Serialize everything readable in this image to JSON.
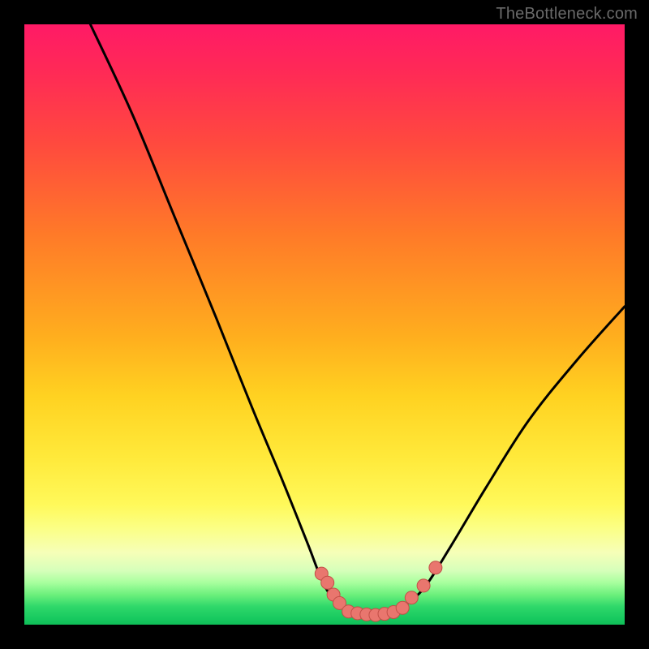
{
  "watermark": "TheBottleneck.com",
  "chart_data": {
    "type": "line",
    "title": "",
    "xlabel": "",
    "ylabel": "",
    "xlim": [
      0,
      100
    ],
    "ylim": [
      0,
      100
    ],
    "grid": false,
    "legend": false,
    "series": [
      {
        "name": "left_curve",
        "x": [
          11,
          18,
          25,
          32,
          38,
          43,
          47,
          50,
          52.5,
          55
        ],
        "y": [
          100,
          85,
          68,
          51,
          36,
          24,
          14,
          6.5,
          3.5,
          2.3
        ]
      },
      {
        "name": "right_curve",
        "x": [
          63,
          66.5,
          71,
          77,
          84,
          92,
          100
        ],
        "y": [
          3,
          6,
          13,
          23,
          34,
          44,
          53
        ]
      },
      {
        "name": "bottom_valley",
        "x": [
          52.5,
          54,
          56,
          58,
          60,
          62,
          63.5
        ],
        "y": [
          3.2,
          2.2,
          1.8,
          1.6,
          1.8,
          2.4,
          3.2
        ]
      }
    ],
    "markers": [
      {
        "name": "left_cluster_1a",
        "x": 49.5,
        "y": 8.5
      },
      {
        "name": "left_cluster_1b",
        "x": 50.5,
        "y": 7.0
      },
      {
        "name": "left_cluster_2a",
        "x": 51.5,
        "y": 5.0
      },
      {
        "name": "left_cluster_2b",
        "x": 52.5,
        "y": 3.6
      },
      {
        "name": "right_cluster_1",
        "x": 64.5,
        "y": 4.5
      },
      {
        "name": "right_cluster_2",
        "x": 66.5,
        "y": 6.5
      },
      {
        "name": "right_cluster_3",
        "x": 68.5,
        "y": 9.5
      },
      {
        "name": "bottom_a",
        "x": 54,
        "y": 2.2
      },
      {
        "name": "bottom_b",
        "x": 55.5,
        "y": 1.9
      },
      {
        "name": "bottom_c",
        "x": 57,
        "y": 1.7
      },
      {
        "name": "bottom_d",
        "x": 58.5,
        "y": 1.6
      },
      {
        "name": "bottom_e",
        "x": 60,
        "y": 1.8
      },
      {
        "name": "bottom_f",
        "x": 61.5,
        "y": 2.1
      },
      {
        "name": "bottom_g",
        "x": 63,
        "y": 2.8
      }
    ],
    "colors": {
      "curve": "#000000",
      "marker_fill": "#e9766e",
      "marker_stroke": "#c24f47",
      "gradient_top": "#ff1a66",
      "gradient_mid": "#ffd221",
      "gradient_bottom": "#0fbe58"
    }
  }
}
